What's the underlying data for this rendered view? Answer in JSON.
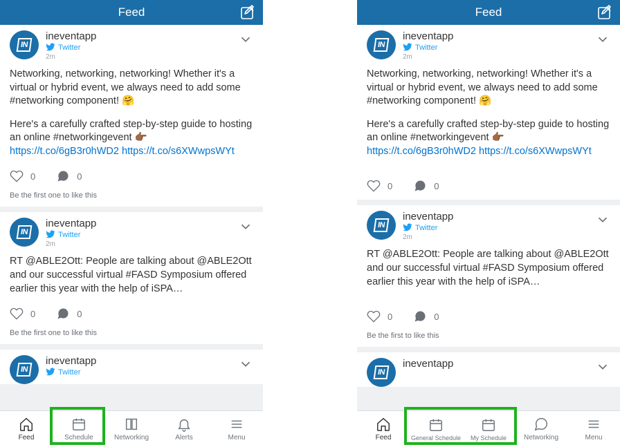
{
  "topbar": {
    "title": "Feed"
  },
  "avatar_text": "IN",
  "post1": {
    "author": "ineventapp",
    "source": "Twitter",
    "time": "2m",
    "body_part1": "Networking, networking, networking! Whether it's a virtual or hybrid event, we always need to add some #networking component! 🤗",
    "body_part2a": "Here's a carefully crafted step-by-step guide to hosting an online #networkingevent 👉🏾 ",
    "link1": "https://t.co/6gB3r0hWD2",
    "sep": " ",
    "link2": "https://t.co/s6XWwpsWYt",
    "likes": "0",
    "comments": "0"
  },
  "post2": {
    "author": "ineventapp",
    "source": "Twitter",
    "time": "2m",
    "body": "RT @ABLE2Ott: People are talking about @ABLE2Ott and our successful virtual #FASD Symposium offered earlier this year with the help of iSPA…",
    "likes": "0",
    "comments": "0"
  },
  "post3": {
    "author": "ineventapp",
    "source": "Twitter"
  },
  "first_like_text_a": "Be the first one to like this",
  "first_like_text_b": "Be the first to like this",
  "nav_left": {
    "feed": "Feed",
    "schedule": "Schedule",
    "networking": "Networking",
    "alerts": "Alerts",
    "menu": "Menu"
  },
  "nav_right": {
    "feed": "Feed",
    "general_schedule": "General Schedule",
    "my_schedule": "My Schedule",
    "networking": "Networking",
    "menu": "Menu"
  }
}
